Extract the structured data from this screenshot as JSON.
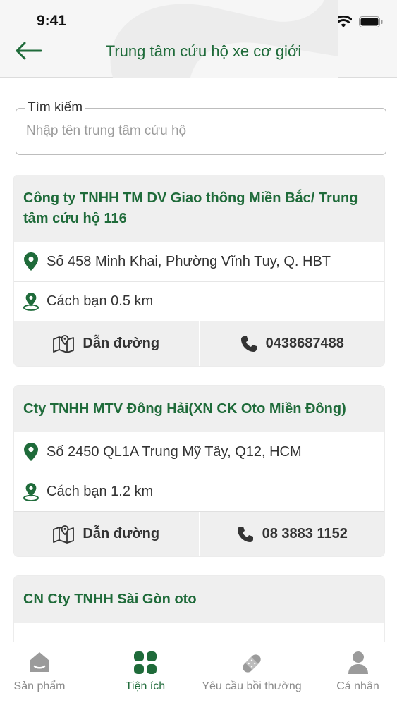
{
  "status_bar": {
    "time": "9:41"
  },
  "header": {
    "title": "Trung tâm cứu hộ xe cơ giới"
  },
  "search": {
    "label": "Tìm kiếm",
    "placeholder": "Nhập tên trung tâm cứu hộ"
  },
  "centers": [
    {
      "name": "Công ty TNHH TM DV Giao thông Miền Bắc/ Trung tâm cứu hộ 116",
      "address": "Số 458 Minh Khai, Phường Vĩnh Tuy, Q. HBT",
      "distance": "Cách bạn 0.5 km",
      "directions_label": "Dẫn đường",
      "phone": "0438687488"
    },
    {
      "name": "Cty TNHH MTV Đông Hải(XN CK Oto Miền Đông)",
      "address": "Số 2450 QL1A Trung Mỹ Tây, Q12, HCM",
      "distance": "Cách bạn 1.2 km",
      "directions_label": "Dẫn đường",
      "phone": "08 3883 1152"
    },
    {
      "name": "CN Cty TNHH Sài Gòn oto"
    }
  ],
  "tabs": [
    {
      "label": "Sản phẩm",
      "icon": "home-icon"
    },
    {
      "label": "Tiện ích",
      "icon": "grid-icon",
      "active": true
    },
    {
      "label": "Yêu cầu bồi thường",
      "icon": "bandage-icon"
    },
    {
      "label": "Cá nhân",
      "icon": "person-icon"
    }
  ],
  "colors": {
    "brand_green": "#1f6b3a",
    "card_header": "#efefef",
    "inactive": "#8a8a8a"
  }
}
